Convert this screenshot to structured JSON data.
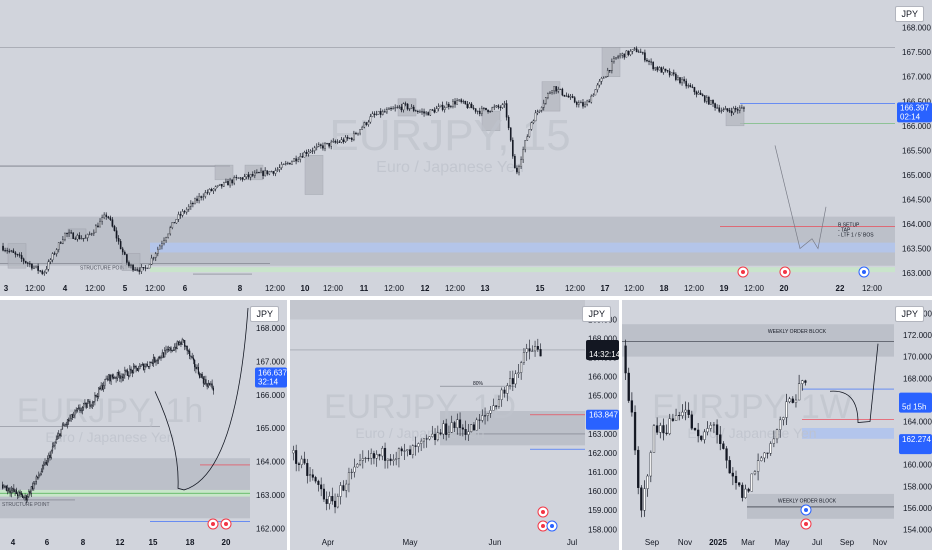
{
  "currency_label": "JPY",
  "colors": {
    "background": "#d1d4dc",
    "candle": "#131722",
    "blue_zone": "#b3c5ec",
    "green_line": "#4caf50",
    "red_line": "#f23645",
    "price_badge": "#2962ff",
    "time_badge": "#131722"
  },
  "panels": [
    {
      "id": "top",
      "watermark": {
        "symbol": "EURJPY, 15",
        "subtitle": "Euro / Japanese Yen"
      },
      "price_badge": {
        "price": "166.397",
        "countdown": "02:14"
      },
      "annotations": {
        "structure_point": "STRUCTURE POINT",
        "b_setup": [
          "B SETUP",
          "- TAP",
          "- LTF 1 / 5' BOS"
        ]
      },
      "chart_data": {
        "type": "candlestick",
        "timeframe": "15m",
        "y_ticks": [
          "168.000",
          "167.500",
          "167.000",
          "166.500",
          "166.000",
          "165.500",
          "165.000",
          "164.500",
          "164.000",
          "163.500",
          "163.000"
        ],
        "x_ticks": [
          "3",
          "12:00",
          "4",
          "12:00",
          "5",
          "12:00",
          "6",
          "8",
          "12:00",
          "10",
          "12:00",
          "11",
          "12:00",
          "12",
          "12:00",
          "13",
          "15",
          "12:00",
          "17",
          "12:00",
          "18",
          "12:00",
          "19",
          "12:00",
          "20",
          "22",
          "12:00"
        ],
        "path": [
          [
            0,
            163.55
          ],
          [
            0.08,
            163.0
          ],
          [
            0.12,
            163.8
          ],
          [
            0.16,
            163.7
          ],
          [
            0.2,
            164.2
          ],
          [
            0.24,
            163.15
          ],
          [
            0.27,
            163.05
          ],
          [
            0.33,
            164.1
          ],
          [
            0.38,
            164.6
          ],
          [
            0.44,
            164.9
          ],
          [
            0.52,
            165.1
          ],
          [
            0.58,
            165.5
          ],
          [
            0.66,
            165.75
          ],
          [
            0.7,
            166.2
          ],
          [
            0.76,
            166.4
          ],
          [
            0.8,
            166.25
          ],
          [
            0.86,
            166.5
          ],
          [
            0.9,
            166.3
          ],
          [
            0.95,
            166.4
          ],
          [
            0.97,
            165.0
          ],
          [
            1.0,
            166.1
          ],
          [
            1.04,
            166.8
          ],
          [
            1.08,
            166.5
          ],
          [
            1.1,
            166.4
          ],
          [
            1.16,
            167.4
          ],
          [
            1.2,
            167.55
          ],
          [
            1.23,
            167.2
          ],
          [
            1.27,
            167.0
          ],
          [
            1.32,
            166.6
          ],
          [
            1.36,
            166.3
          ],
          [
            1.4,
            166.35
          ]
        ],
        "last_price": 166.397,
        "y_range": [
          162.9,
          168.4
        ]
      }
    },
    {
      "id": "bottom-left",
      "watermark": {
        "symbol": "EURJPY, 1h",
        "subtitle": "Euro / Japanese Yen"
      },
      "price_badge": {
        "price": "166.637",
        "countdown": "32:14"
      },
      "annotations": {
        "structure_point": "STRUCTURE POINT"
      },
      "chart_data": {
        "type": "candlestick",
        "timeframe": "1h",
        "y_ticks": [
          "168.000",
          "167.000",
          "166.000",
          "165.000",
          "164.000",
          "163.000",
          "162.000"
        ],
        "x_ticks": [
          "4",
          "6",
          "8",
          "12",
          "15",
          "18",
          "20"
        ],
        "path": [
          [
            0,
            163.3
          ],
          [
            0.08,
            162.9
          ],
          [
            0.15,
            164.0
          ],
          [
            0.2,
            165.0
          ],
          [
            0.25,
            165.5
          ],
          [
            0.3,
            165.8
          ],
          [
            0.35,
            166.5
          ],
          [
            0.4,
            166.6
          ],
          [
            0.48,
            166.9
          ],
          [
            0.55,
            167.3
          ],
          [
            0.6,
            167.6
          ],
          [
            0.63,
            167.0
          ],
          [
            0.67,
            166.4
          ],
          [
            0.7,
            166.2
          ]
        ],
        "last_price": 166.637,
        "y_range": [
          161.8,
          168.6
        ]
      }
    },
    {
      "id": "bottom-middle",
      "watermark": {
        "symbol": "EURJPY, 1D",
        "subtitle": "Euro / Japanese Yen"
      },
      "price_badge": {
        "price": "163.847",
        "countdown": "14:32:14"
      },
      "annotations": {
        "level": "80%"
      },
      "chart_data": {
        "type": "candlestick",
        "timeframe": "1D",
        "y_ticks": [
          "169.000",
          "168.000",
          "167.000",
          "166.000",
          "165.000",
          "164.000",
          "163.000",
          "162.000",
          "161.000",
          "160.000",
          "159.000",
          "158.000"
        ],
        "x_ticks": [
          "Apr",
          "May",
          "Jun",
          "Jul"
        ],
        "path": [
          [
            0,
            162.0
          ],
          [
            0.08,
            160.6
          ],
          [
            0.15,
            159.2
          ],
          [
            0.2,
            160.6
          ],
          [
            0.28,
            161.6
          ],
          [
            0.35,
            162.0
          ],
          [
            0.42,
            161.9
          ],
          [
            0.5,
            162.6
          ],
          [
            0.58,
            163.5
          ],
          [
            0.65,
            163.2
          ],
          [
            0.7,
            163.9
          ],
          [
            0.78,
            165.5
          ],
          [
            0.85,
            167.2
          ],
          [
            0.88,
            167.5
          ],
          [
            0.9,
            167.0
          ]
        ],
        "last_price": 163.847,
        "y_range": [
          157.7,
          169.6
        ]
      }
    },
    {
      "id": "bottom-right",
      "watermark": {
        "symbol": "EURJPY, 1W",
        "subtitle": "Euro / Japanese Yen"
      },
      "price_badge": {
        "price": "162.274",
        "countdown": "5d 15h"
      },
      "annotations": {
        "top_block": "WEEKLY ORDER BLOCK",
        "bottom_block": "WEEKLY ORDER BLOCK"
      },
      "chart_data": {
        "type": "candlestick",
        "timeframe": "1W",
        "y_ticks": [
          "174.000",
          "172.000",
          "170.000",
          "168.000",
          "166.000",
          "164.000",
          "162.000",
          "160.000",
          "158.000",
          "156.000",
          "154.000"
        ],
        "x_ticks": [
          "Sep",
          "Nov",
          "2025",
          "Mar",
          "May",
          "Jul",
          "Sep",
          "Nov"
        ],
        "path": [
          [
            0,
            171.0
          ],
          [
            0.03,
            164.5
          ],
          [
            0.06,
            155.0
          ],
          [
            0.1,
            163.0
          ],
          [
            0.15,
            163.6
          ],
          [
            0.2,
            165.5
          ],
          [
            0.25,
            162.0
          ],
          [
            0.3,
            164.0
          ],
          [
            0.35,
            159.0
          ],
          [
            0.4,
            157.0
          ],
          [
            0.44,
            160.0
          ],
          [
            0.5,
            162.6
          ],
          [
            0.55,
            166.0
          ],
          [
            0.6,
            167.5
          ]
        ],
        "last_price": 162.274,
        "y_range": [
          153.5,
          174.5
        ]
      }
    }
  ]
}
